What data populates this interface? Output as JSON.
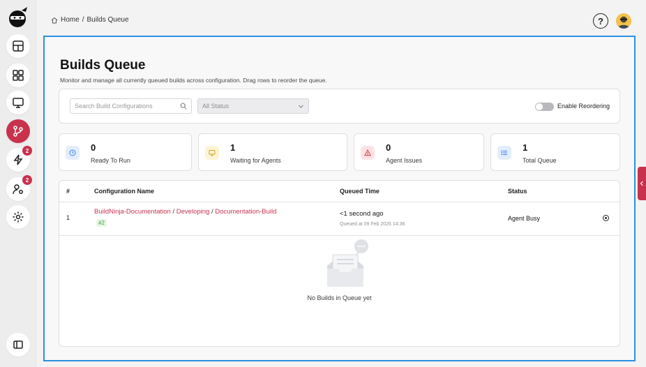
{
  "breadcrumb": {
    "home": "Home",
    "separator": "/",
    "current": "Builds Queue"
  },
  "header": {
    "help_label": "?"
  },
  "sidebar": {
    "items": [
      {
        "name": "dashboard",
        "icon": "layout-icon"
      },
      {
        "name": "projects",
        "icon": "grid-icon"
      },
      {
        "name": "agents",
        "icon": "monitor-icon"
      },
      {
        "name": "builds",
        "icon": "git-branch-icon",
        "active": true
      },
      {
        "name": "triggers",
        "icon": "lightning-icon",
        "badge": "2"
      },
      {
        "name": "users",
        "icon": "user-gear-icon",
        "badge": "2"
      },
      {
        "name": "settings",
        "icon": "gear-icon"
      },
      {
        "name": "collapse",
        "icon": "sidebar-icon"
      }
    ]
  },
  "page": {
    "title": "Builds Queue",
    "description": "Monitor and manage all currently queued builds across configuration. Drag rows to reorder the queue."
  },
  "filters": {
    "search_placeholder": "Search Build Configurations",
    "status_value": "All Status",
    "reorder_label": "Enable Reordering"
  },
  "stats": [
    {
      "value": "0",
      "label": "Ready To Run",
      "icon": "clock-icon",
      "color": "#3b82f6",
      "bg": "#e3eefc"
    },
    {
      "value": "1",
      "label": "Waiting for Agents",
      "icon": "monitor-icon",
      "color": "#d4a017",
      "bg": "#fdf4d6"
    },
    {
      "value": "0",
      "label": "Agent Issues",
      "icon": "warning-icon",
      "color": "#d93a4a",
      "bg": "#fbe3e5"
    },
    {
      "value": "1",
      "label": "Total Queue",
      "icon": "list-icon",
      "color": "#3b82f6",
      "bg": "#e3eefc"
    }
  ],
  "table": {
    "headers": {
      "num": "#",
      "config": "Configuration Name",
      "queued": "Queued Time",
      "status": "Status"
    },
    "rows": [
      {
        "num": "1",
        "project": "BuildNinja-Documentation",
        "branch": "Developing",
        "config": "Documentation-Build",
        "separator": "/",
        "build_number": "#2",
        "queued": "<1 second ago",
        "queued_at": "Queued at 09 Feb 2026 14:36",
        "status": "Agent Busy"
      }
    ],
    "empty_text": "No Builds in Queue yet"
  },
  "colors": {
    "accent": "#c9324d",
    "frame": "#2b8fe0"
  }
}
